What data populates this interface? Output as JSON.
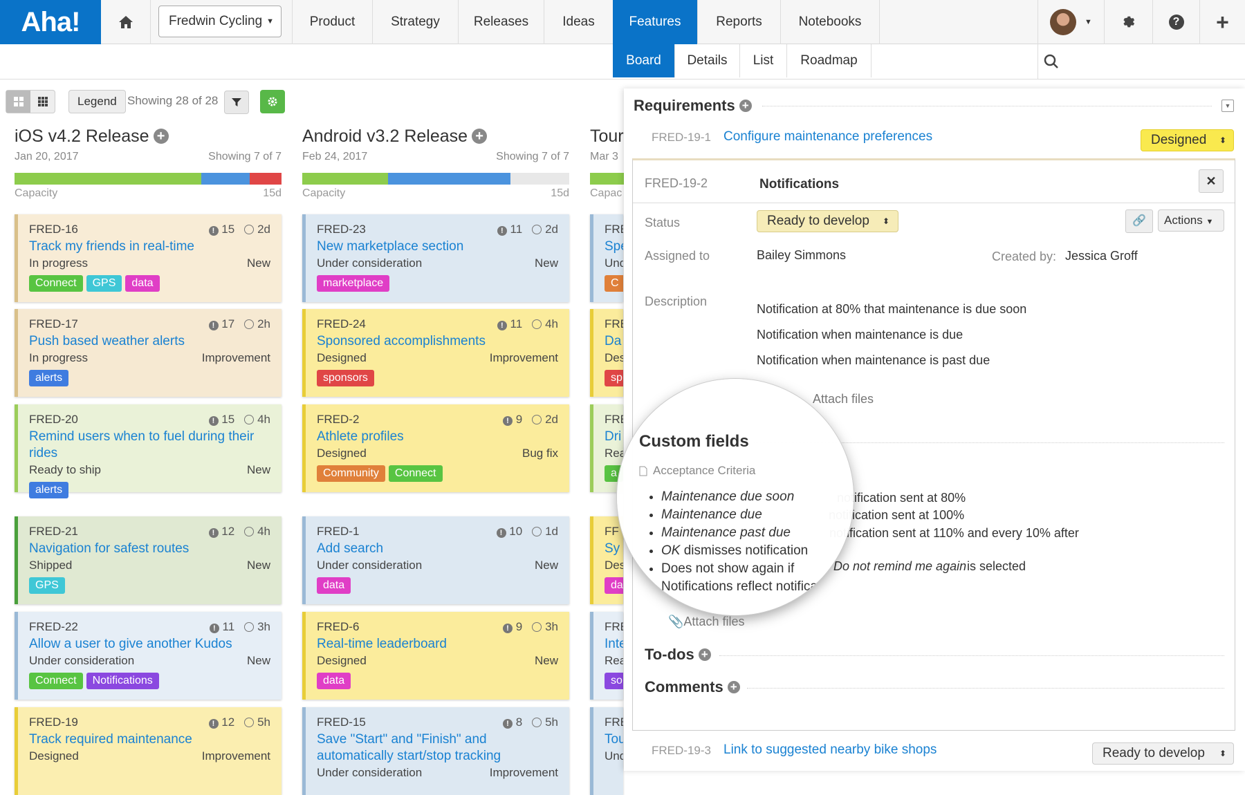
{
  "app": {
    "logo": "Aha!"
  },
  "topnav": {
    "workspace": "Fredwin Cycling",
    "items": [
      "Product",
      "Strategy",
      "Releases",
      "Ideas",
      "Features",
      "Reports",
      "Notebooks"
    ],
    "active": "Features"
  },
  "subnav": {
    "items": [
      "Board",
      "Details",
      "List",
      "Roadmap"
    ],
    "active": "Board"
  },
  "toolbar": {
    "legend": "Legend",
    "showing": "Showing 28 of 28"
  },
  "columns": [
    {
      "title": "iOS v4.2 Release",
      "date": "Jan 20, 2017",
      "showing": "Showing 7 of 7",
      "capacity_label": "Capacity",
      "capacity_value": "15d",
      "cards": [
        {
          "id": "FRED-16",
          "score": "15",
          "time": "2d",
          "title": "Track my friends in real-time",
          "status": "In progress",
          "type": "New",
          "tags": [
            "Connect",
            "GPS",
            "data"
          ]
        },
        {
          "id": "FRED-17",
          "score": "17",
          "time": "2h",
          "title": "Push based weather alerts",
          "status": "In progress",
          "type": "Improvement",
          "tags": [
            "alerts"
          ]
        },
        {
          "id": "FRED-20",
          "score": "15",
          "time": "4h",
          "title": "Remind users when to fuel during their rides",
          "status": "Ready to ship",
          "type": "New",
          "tags": [
            "alerts"
          ]
        },
        {
          "id": "FRED-21",
          "score": "12",
          "time": "4h",
          "title": "Navigation for safest routes",
          "status": "Shipped",
          "type": "New",
          "tags": [
            "GPS"
          ]
        },
        {
          "id": "FRED-22",
          "score": "11",
          "time": "3h",
          "title": "Allow a user to give another Kudos",
          "status": "Under consideration",
          "type": "New",
          "tags": [
            "Connect",
            "Notifications"
          ]
        },
        {
          "id": "FRED-19",
          "score": "12",
          "time": "5h",
          "title": "Track required maintenance",
          "status": "Designed",
          "type": "Improvement",
          "tags": []
        }
      ]
    },
    {
      "title": "Android v3.2 Release",
      "date": "Feb 24, 2017",
      "showing": "Showing 7 of 7",
      "capacity_label": "Capacity",
      "capacity_value": "15d",
      "cards": [
        {
          "id": "FRED-23",
          "score": "11",
          "time": "2d",
          "title": "New marketplace section",
          "status": "Under consideration",
          "type": "New",
          "tags": [
            "marketplace"
          ]
        },
        {
          "id": "FRED-24",
          "score": "11",
          "time": "4h",
          "title": "Sponsored accomplishments",
          "status": "Designed",
          "type": "Improvement",
          "tags": [
            "sponsors"
          ]
        },
        {
          "id": "FRED-2",
          "score": "9",
          "time": "2d",
          "title": "Athlete profiles",
          "status": "Designed",
          "type": "Bug fix",
          "tags": [
            "Community",
            "Connect"
          ]
        },
        {
          "id": "FRED-1",
          "score": "10",
          "time": "1d",
          "title": "Add search",
          "status": "Under consideration",
          "type": "New",
          "tags": [
            "data"
          ]
        },
        {
          "id": "FRED-6",
          "score": "9",
          "time": "3h",
          "title": "Real-time leaderboard",
          "status": "Designed",
          "type": "New",
          "tags": [
            "data"
          ]
        },
        {
          "id": "FRED-15",
          "score": "8",
          "time": "5h",
          "title": "Save \"Start\" and \"Finish\" and automatically start/stop tracking",
          "status": "Under consideration",
          "type": "Improvement",
          "tags": []
        }
      ]
    },
    {
      "title": "Tour",
      "date": "Mar 3",
      "capacity_label": "Capac",
      "cards": [
        {
          "id": "FRE",
          "title": "Spe",
          "status": "Und",
          "tag": "C"
        },
        {
          "id": "FRE",
          "title": "Da",
          "status": "Des",
          "tag": "sp"
        },
        {
          "id": "FRE",
          "title": "Dri",
          "status": "Rea",
          "tag": "a"
        },
        {
          "id": "FF",
          "title": "Sy",
          "status": "Des",
          "tag": "da"
        },
        {
          "id": "FRE",
          "title": "Inte",
          "status": "Rea",
          "tag": "so"
        },
        {
          "id": "FRE",
          "title": "Tou",
          "status": "Und",
          "tag": ""
        }
      ]
    }
  ],
  "tag_colors": {
    "Connect": "#58c442",
    "GPS": "#3fc7d6",
    "data": "#e03ec6",
    "alerts": "#3f7ce0",
    "Notifications": "#8b48e0",
    "marketplace": "#e03ec6",
    "sponsors": "#e04646",
    "Community": "#e0803a"
  },
  "panel": {
    "requirements_title": "Requirements",
    "req1": {
      "id": "FRED-19-1",
      "title": "Configure maintenance preferences",
      "status": "Designed"
    },
    "detail": {
      "id": "FRED-19-2",
      "title": "Notifications",
      "status_label": "Status",
      "status": "Ready to develop",
      "actions": "Actions",
      "assigned_label": "Assigned to",
      "assigned": "Bailey Simmons",
      "created_label": "Created by:",
      "created_by": "Jessica Groff",
      "description_label": "Description",
      "description": [
        "Notification at 80% that maintenance is due soon",
        "Notification when maintenance is due",
        "Notification when maintenance is past due"
      ],
      "attach": "Attach files",
      "custom_fields": "Custom fields",
      "acceptance": "Acceptance Criteria",
      "criteria": [
        {
          "em": "Maintenance due soon",
          "rest": " notification sent at 80%"
        },
        {
          "em": "Maintenance due",
          "rest": " notification sent at 100%"
        },
        {
          "em": "Maintenance past due",
          "rest": " notification sent at 110% and every 10% after"
        },
        {
          "em": "OK",
          "rest": " dismisses notification"
        },
        {
          "pre": "Does not show again if ",
          "em": "Do not remind me again",
          "rest": " is selected"
        },
        {
          "pre": "Notifications reflect notification preferences",
          "em": "",
          "rest": ""
        }
      ],
      "attach2": "Attach files",
      "todos": "To-dos",
      "comments": "Comments"
    },
    "req3": {
      "id": "FRED-19-3",
      "title": "Link to suggested nearby bike shops",
      "status": "Ready to develop"
    }
  }
}
